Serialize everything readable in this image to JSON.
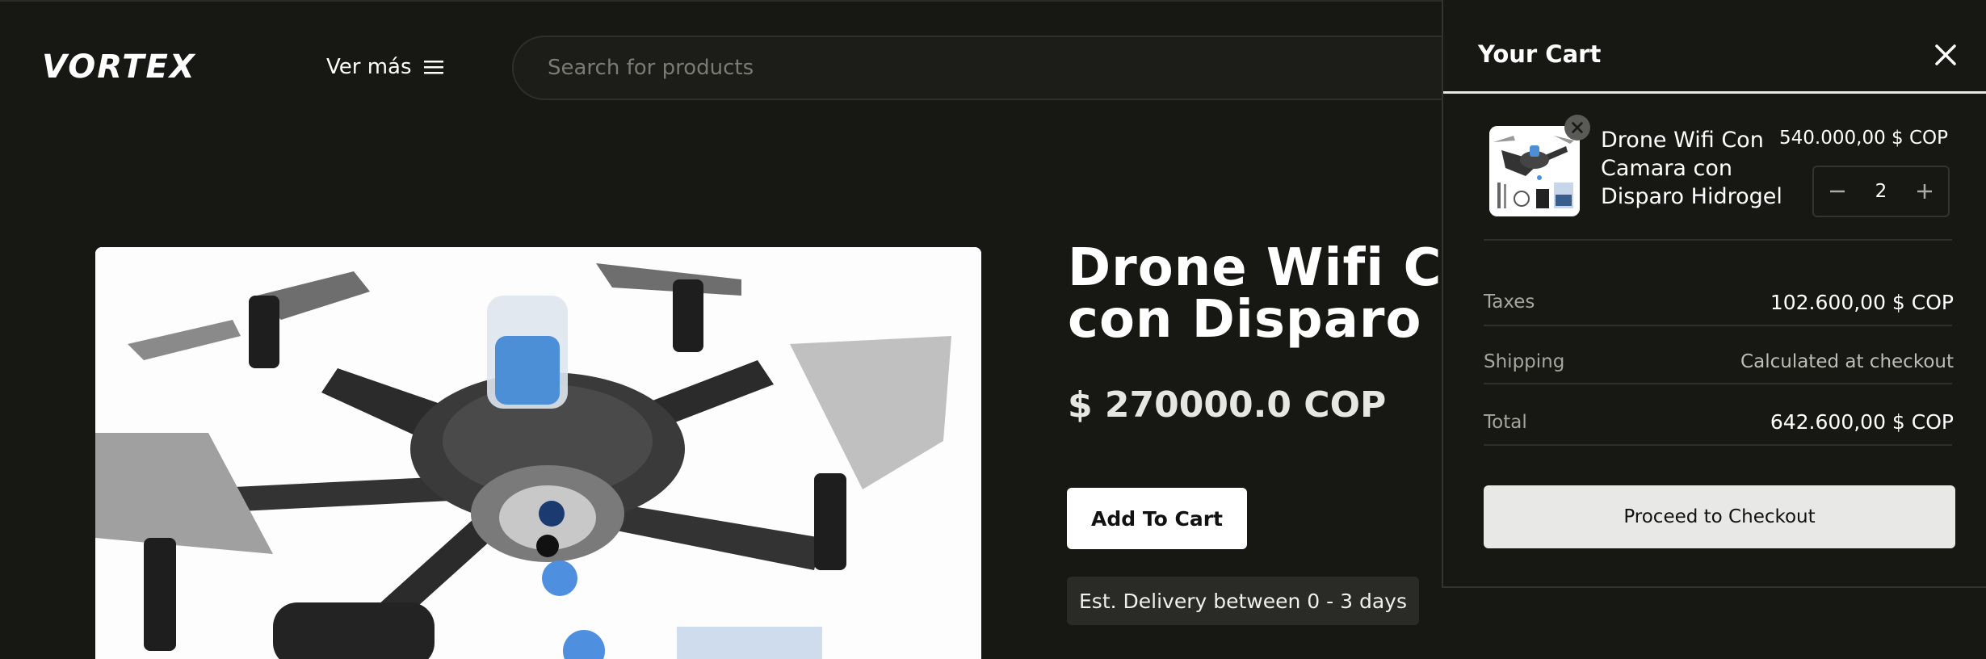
{
  "header": {
    "logo_text": "VORTEX",
    "menu_label": "Ver más",
    "search_placeholder": "Search for products"
  },
  "product": {
    "title_line1": "Drone Wifi Con Camara",
    "title_line2": "con Disparo Hidrogel",
    "price": "$ 270000.0 COP",
    "add_to_cart_label": "Add To Cart",
    "delivery_text": "Est. Delivery between 0 - 3 days"
  },
  "cart": {
    "title": "Your Cart",
    "items": [
      {
        "name": "Drone Wifi Con Camara con Disparo Hidrogel",
        "price": "540.000,00 $ COP",
        "quantity": "2"
      }
    ],
    "taxes_label": "Taxes",
    "taxes_value": "102.600,00 $ COP",
    "shipping_label": "Shipping",
    "shipping_value": "Calculated at checkout",
    "total_label": "Total",
    "total_value": "642.600,00 $ COP",
    "checkout_label": "Proceed to Checkout"
  },
  "icons": {
    "menu": "hamburger-icon",
    "close": "close-icon",
    "remove_item": "remove-circle-icon",
    "decrease": "minus-icon",
    "increase": "plus-icon"
  },
  "colors": {
    "background": "#171714",
    "accent_text": "#ffffff",
    "button_bg": "#ffffff",
    "checkout_bg": "#e8e8e6"
  }
}
